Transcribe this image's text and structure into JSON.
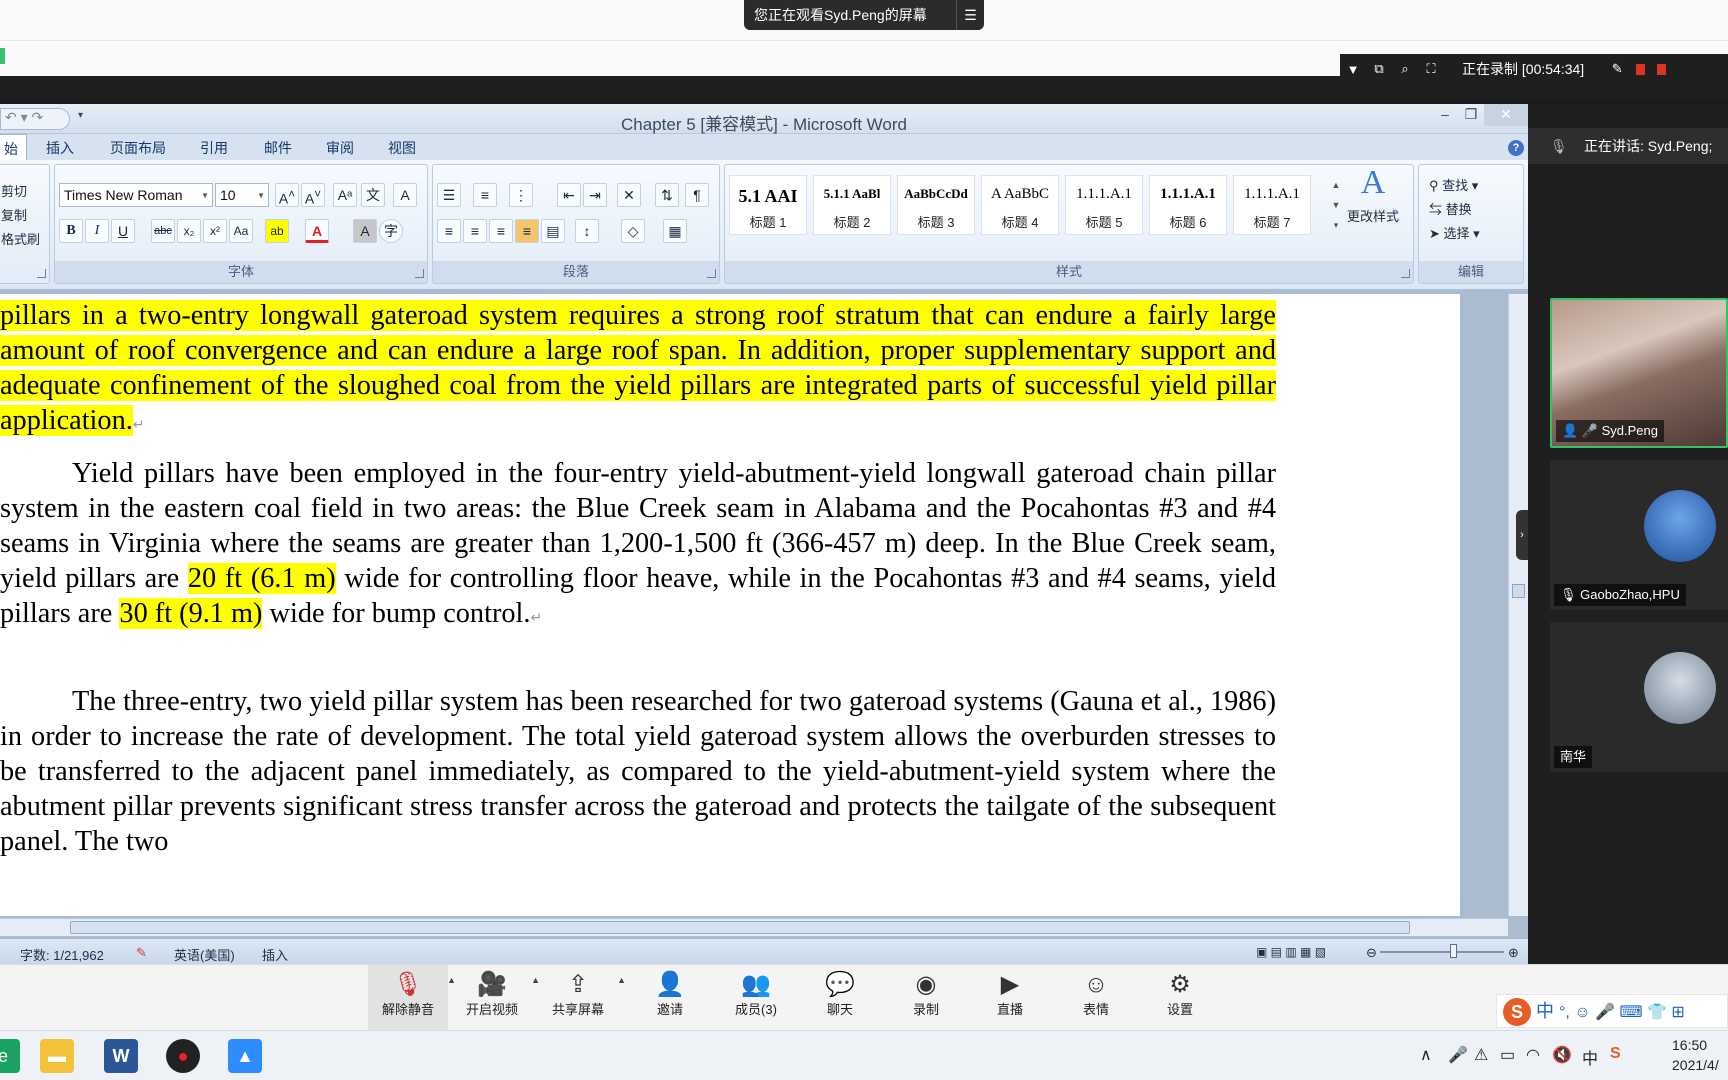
{
  "banner": {
    "viewing": "您正在观看Syd.Peng的屏幕",
    "menu_icon": "list-icon"
  },
  "recording": {
    "text": "正在录制 [00:54:34]"
  },
  "word": {
    "title": "Chapter 5 [兼容模式] - Microsoft Word",
    "tabs": [
      "始",
      "插入",
      "页面布局",
      "引用",
      "邮件",
      "审阅",
      "视图"
    ],
    "clipboard": {
      "cut": "剪切",
      "copy": "复制",
      "format_painter": "格式刷"
    },
    "font": {
      "name": "Times New Roman",
      "size": "10",
      "group_label": "字体"
    },
    "paragraph": {
      "group_label": "段落"
    },
    "styles": {
      "group_label": "样式",
      "items": [
        {
          "sample": "5.1 AAI",
          "name": "标题 1"
        },
        {
          "sample": "5.1.1 AaBl",
          "name": "标题 2"
        },
        {
          "sample": "AaBbCcDd",
          "name": "标题 3"
        },
        {
          "sample": "A AaBbC",
          "name": "标题 4"
        },
        {
          "sample": "1.1.1.A.1",
          "name": "标题 5"
        },
        {
          "sample": "1.1.1.A.1",
          "name": "标题 6"
        },
        {
          "sample": "1.1.1.A.1",
          "name": "标题 7"
        }
      ],
      "change_styles": "更改样式"
    },
    "editing": {
      "find": "查找",
      "replace": "替换",
      "select": "选择",
      "group_label": "编辑"
    },
    "document": {
      "p1": "pillars in a two-entry longwall gateroad system requires a strong roof stratum that can endure a fairly large amount of roof convergence and can endure a large roof span. In addition, proper supplementary support and adequate confinement of the sloughed coal from the yield pillars are integrated parts of successful yield pillar application.",
      "p2_a": "Yield pillars have been employed in the four-entry yield-abutment-yield longwall gateroad chain pillar system in the eastern coal field in two areas: the Blue Creek seam in Alabama and the Pocahontas #3 and #4 seams in Virginia where the seams are greater than 1,200-1,500 ft (366-457 m) deep. In the Blue Creek seam, yield pillars are ",
      "p2_hl1": "20 ft (6.1 m)",
      "p2_b": " wide for controlling floor heave, while in the Pocahontas #3 and #4 seams, yield pillars are ",
      "p2_hl2": "30 ft (9.1 m)",
      "p2_c": " wide for bump control.",
      "p3": "The three-entry, two yield pillar system has been researched for two gateroad systems (Gauna et al., 1986) in order to increase the rate of development. The total yield gateroad system allows the overburden stresses to be transferred to the adjacent panel immediately, as compared to the yield-abutment-yield system where the abutment pillar prevents significant stress transfer across the gateroad and protects the tailgate of the subsequent panel. The two"
    },
    "status": {
      "word_count": "字数: 1/21,962",
      "language": "英语(美国)",
      "mode": "插入"
    }
  },
  "meeting": {
    "speaking": "正在讲话: Syd.Peng;",
    "participants": [
      {
        "name": "Syd.Peng"
      },
      {
        "name": "GaoboZhao,HPU"
      },
      {
        "name": "南华"
      }
    ],
    "toolbar": [
      {
        "label": "解除静音",
        "icon": "mic-muted-icon"
      },
      {
        "label": "开启视频",
        "icon": "video-off-icon"
      },
      {
        "label": "共享屏幕",
        "icon": "share-screen-icon"
      },
      {
        "label": "邀请",
        "icon": "invite-icon"
      },
      {
        "label": "成员(3)",
        "icon": "participants-icon"
      },
      {
        "label": "聊天",
        "icon": "chat-icon"
      },
      {
        "label": "录制",
        "icon": "record-icon"
      },
      {
        "label": "直播",
        "icon": "live-icon"
      },
      {
        "label": "表情",
        "icon": "emoji-icon"
      },
      {
        "label": "设置",
        "icon": "settings-icon"
      }
    ]
  },
  "ime": {
    "lang": "中"
  },
  "taskbar": {
    "time": "16:50",
    "date": "2021/4/"
  }
}
